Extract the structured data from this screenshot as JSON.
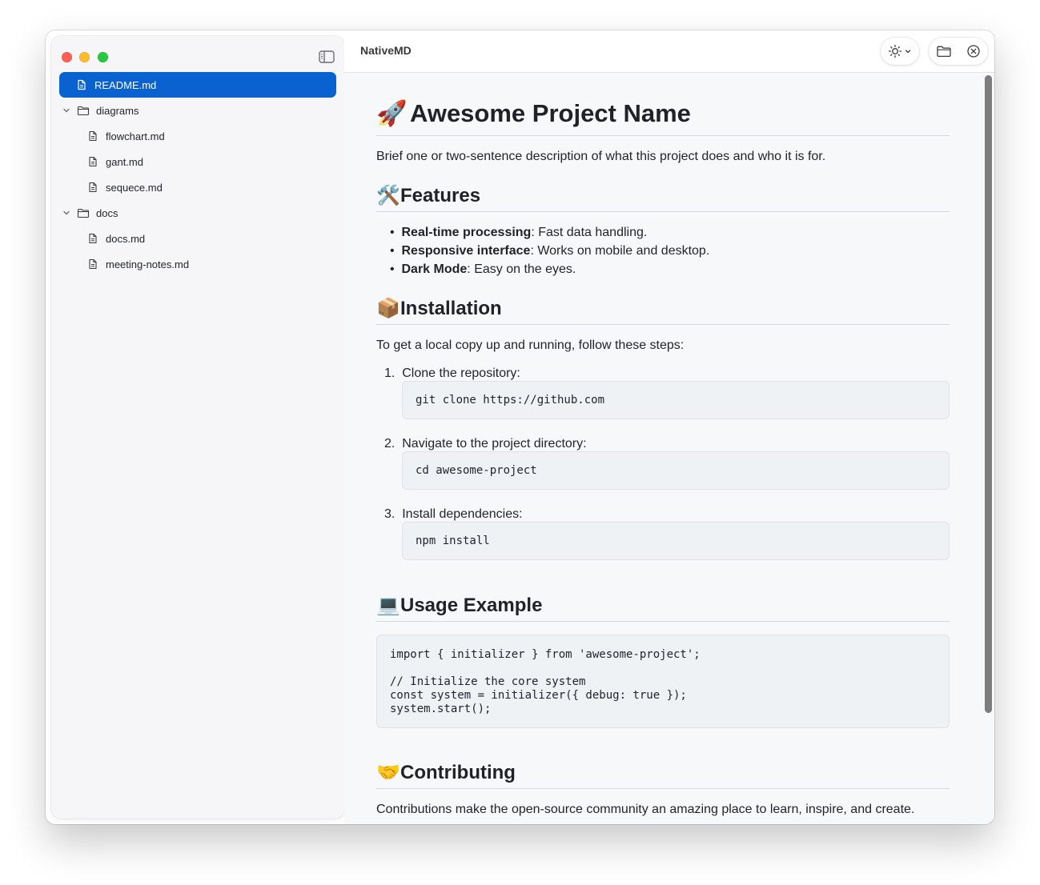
{
  "window": {
    "title": "NativeMD"
  },
  "sidebar": {
    "items": [
      {
        "label": "README.md",
        "type": "file",
        "selected": true
      },
      {
        "label": "diagrams",
        "type": "folder",
        "expanded": true
      },
      {
        "label": "flowchart.md",
        "type": "file"
      },
      {
        "label": "gant.md",
        "type": "file"
      },
      {
        "label": "sequece.md",
        "type": "file"
      },
      {
        "label": "docs",
        "type": "folder",
        "expanded": true
      },
      {
        "label": "docs.md",
        "type": "file"
      },
      {
        "label": "meeting-notes.md",
        "type": "file"
      }
    ]
  },
  "toolbar": {
    "theme_icon": "sun-icon",
    "open_folder_icon": "folder-icon",
    "close_icon": "close-circle-icon"
  },
  "doc": {
    "h1_emoji": "🚀",
    "h1": "Awesome Project Name",
    "intro": "Brief one or two-sentence description of what this project does and who it is for.",
    "features": {
      "emoji": "🛠️",
      "heading": "Features",
      "items": [
        {
          "bold": "Real-time processing",
          "text": ": Fast data handling."
        },
        {
          "bold": "Responsive interface",
          "text": ": Works on mobile and desktop."
        },
        {
          "bold": "Dark Mode",
          "text": ": Easy on the eyes."
        }
      ]
    },
    "installation": {
      "emoji": "📦",
      "heading": "Installation",
      "intro": "To get a local copy up and running, follow these steps:",
      "steps": [
        {
          "num": "1.",
          "text": "Clone the repository:",
          "code": "git clone https://github.com"
        },
        {
          "num": "2.",
          "text": "Navigate to the project directory:",
          "code": "cd awesome-project"
        },
        {
          "num": "3.",
          "text": "Install dependencies:",
          "code": "npm install"
        }
      ]
    },
    "usage": {
      "emoji": "💻",
      "heading": "Usage Example",
      "code": "import { initializer } from 'awesome-project';\n\n// Initialize the core system\nconst system = initializer({ debug: true });\nsystem.start();"
    },
    "contributing": {
      "emoji": "🤝",
      "heading": "Contributing",
      "text": "Contributions make the open-source community an amazing place to learn, inspire, and create."
    }
  }
}
